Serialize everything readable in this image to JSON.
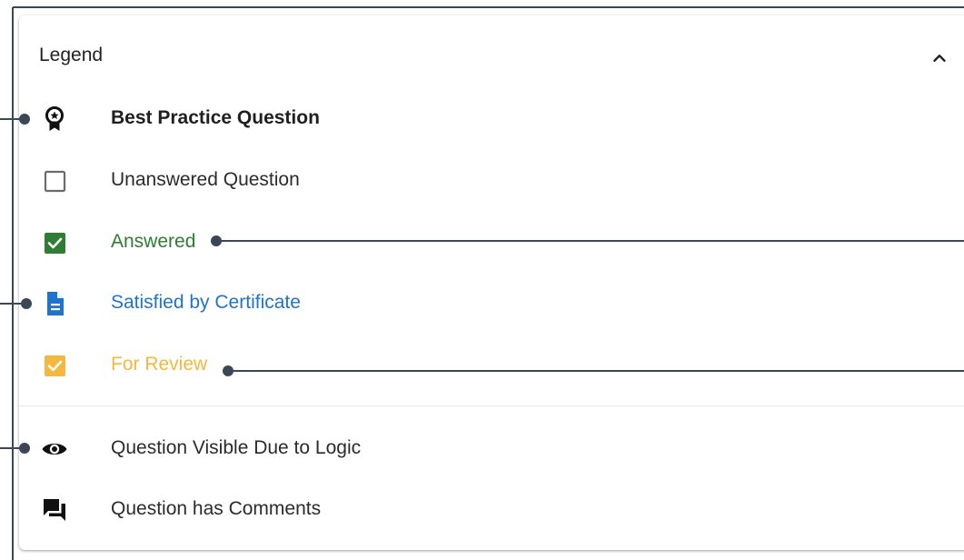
{
  "legend": {
    "title": "Legend",
    "collapse_icon": "chevron-up-icon",
    "items": [
      {
        "label": "Best Practice Question",
        "icon": "award-ribbon-icon",
        "color": "#1f1f1f",
        "bold": true
      },
      {
        "label": "Unanswered Question",
        "icon": "checkbox-empty-icon",
        "color": "#2b2b2b"
      },
      {
        "label": "Answered",
        "icon": "checkbox-checked-green-icon",
        "color": "#2e7d32"
      },
      {
        "label": "Satisfied by Certificate",
        "icon": "document-icon",
        "color": "#1e73cf"
      },
      {
        "label": "For Review",
        "icon": "checkbox-checked-yellow-icon",
        "color": "#f4b740"
      },
      {
        "label": "Question Visible Due to Logic",
        "icon": "eye-icon",
        "color": "#2b2b2b"
      },
      {
        "label": "Question has Comments",
        "icon": "comments-icon",
        "color": "#2b2b2b"
      }
    ]
  },
  "colors": {
    "callout_line": "#3b4657",
    "answered_green": "#2e7d32",
    "certificate_blue": "#1e73cf",
    "review_yellow": "#f4b740"
  }
}
